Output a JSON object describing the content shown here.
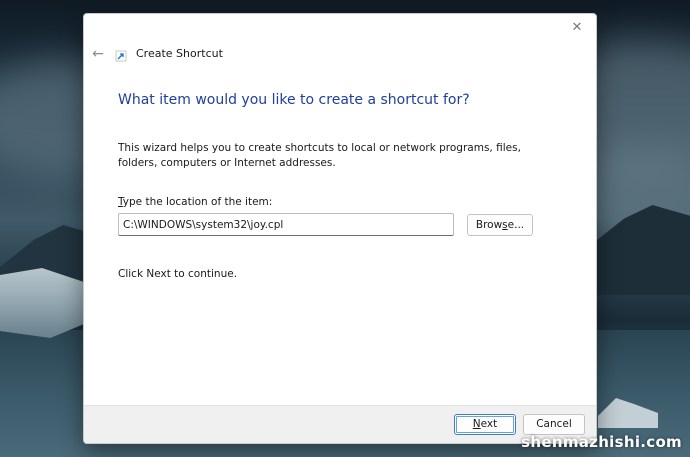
{
  "dialog": {
    "title": "Create Shortcut",
    "heading": "What item would you like to create a shortcut for?",
    "description": "This wizard helps you to create shortcuts to local or network programs, files, folders, computers or Internet addresses.",
    "location_label_first": "T",
    "location_label_rest": "ype the location of the item:",
    "location_value": "C:\\WINDOWS\\system32\\joy.cpl",
    "browse_label_pre": "Brow",
    "browse_label_ul": "s",
    "browse_label_post": "e...",
    "continue_text": "Click Next to continue.",
    "next_label_ul": "N",
    "next_label_rest": "ext",
    "cancel_label": "Cancel",
    "close_glyph": "✕",
    "back_glyph": "←",
    "accent_color": "#1e3f9c",
    "icons": [
      "back-arrow-icon",
      "shortcut-icon",
      "close-icon"
    ]
  },
  "watermark": "shenmazhishi.com"
}
